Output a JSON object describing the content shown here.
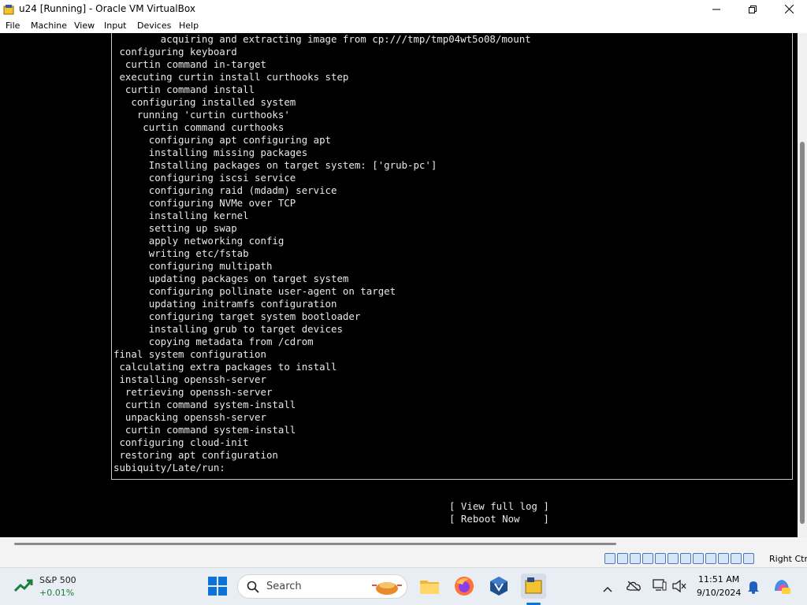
{
  "window": {
    "title": "u24 [Running] - Oracle VM VirtualBox",
    "controls": [
      "minimize-icon",
      "maximize-icon",
      "close-icon"
    ]
  },
  "menu": {
    "items": [
      "File",
      "Machine",
      "View",
      "Input",
      "Devices",
      "Help"
    ]
  },
  "console": {
    "lines": [
      "        acquiring and extracting image from cp:///tmp/tmp04wt5o08/mount",
      " configuring keyboard",
      "  curtin command in-target",
      " executing curtin install curthooks step",
      "  curtin command install",
      "   configuring installed system",
      "    running 'curtin curthooks'",
      "     curtin command curthooks",
      "      configuring apt configuring apt",
      "      installing missing packages",
      "      Installing packages on target system: ['grub-pc']",
      "      configuring iscsi service",
      "      configuring raid (mdadm) service",
      "      configuring NVMe over TCP",
      "      installing kernel",
      "      setting up swap",
      "      apply networking config",
      "      writing etc/fstab",
      "      configuring multipath",
      "      updating packages on target system",
      "      configuring pollinate user-agent on target",
      "      updating initramfs configuration",
      "      configuring target system bootloader",
      "      installing grub to target devices",
      "      copying metadata from /cdrom",
      "final system configuration",
      " calculating extra packages to install",
      " installing openssh-server",
      "  retrieving openssh-server",
      "  curtin command system-install",
      "  unpacking openssh-server",
      "  curtin command system-install",
      " configuring cloud-init",
      " restoring apt configuration",
      "subiquity/Late/run:"
    ],
    "actions": [
      "[ View full log ]",
      "[ Reboot Now    ]"
    ]
  },
  "statusbar": {
    "host_key": "Right Ctrl",
    "icons": [
      "hard-disk-icon",
      "optical-drive-icon",
      "audio-icon",
      "network-icon",
      "usb-icon",
      "shared-folders-icon",
      "display-icon",
      "video-capture-icon",
      "recording-icon",
      "cpu-icon",
      "mouse-integration-icon",
      "keyboard-icon"
    ]
  },
  "taskbar": {
    "stock": {
      "name": "S&P 500",
      "change": "+0.01%"
    },
    "search_placeholder": "Search",
    "apps": [
      "start-icon",
      "search-icon",
      "decorative-search-art-icon",
      "file-explorer-icon",
      "firefox-icon",
      "virtualbox-icon",
      "running-vm-icon"
    ],
    "tray": [
      "chevron-up-icon",
      "onedrive-icon",
      "display-icon",
      "sound-icon",
      "notification-bell-icon",
      "copilot-icon"
    ],
    "time": "11:51 AM",
    "date": "9/10/2024"
  },
  "colors": {
    "console_bg": "#000000",
    "console_fg": "#e8e8e8",
    "taskbar_bg": "#e9eef5"
  }
}
